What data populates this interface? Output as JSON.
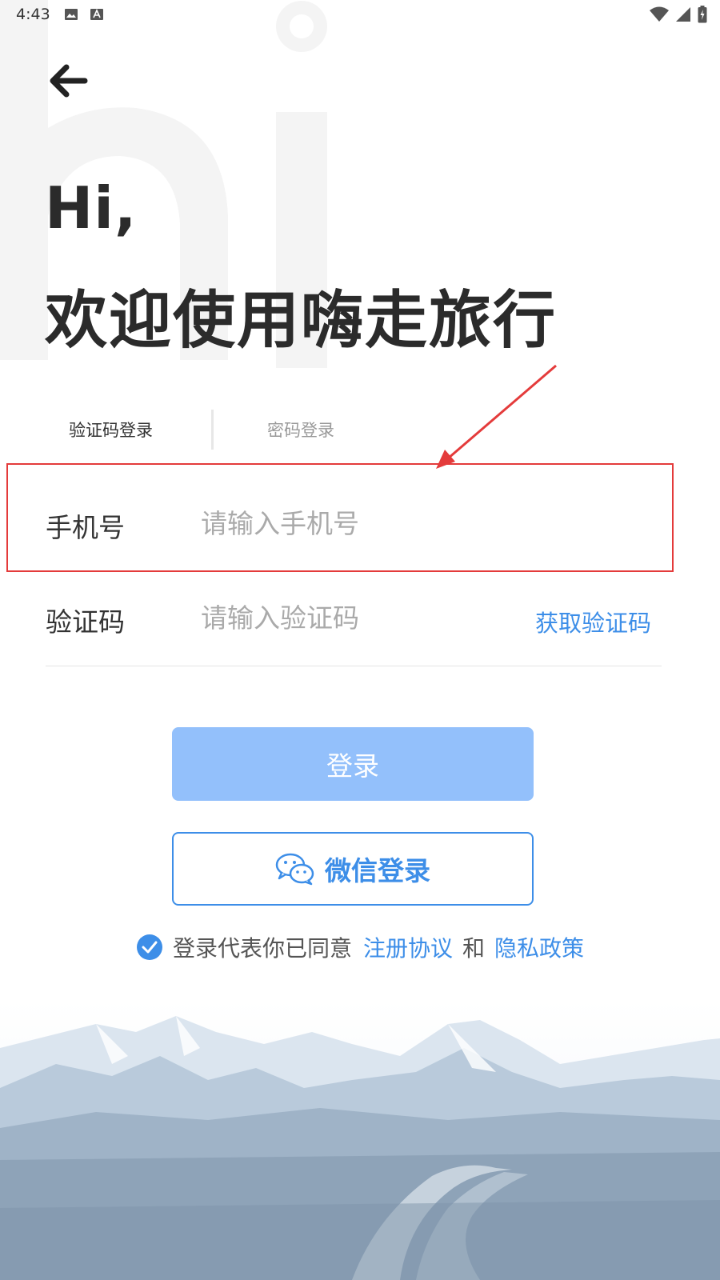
{
  "status_bar": {
    "time": "4:43"
  },
  "greeting": {
    "hi": "Hi,",
    "welcome": "欢迎使用嗨走旅行"
  },
  "tabs": [
    {
      "label": "验证码登录",
      "active": true
    },
    {
      "label": "密码登录",
      "active": false
    }
  ],
  "form": {
    "phone": {
      "label": "手机号",
      "placeholder": "请输入手机号",
      "value": ""
    },
    "code": {
      "label": "验证码",
      "placeholder": "请输入验证码",
      "value": ""
    },
    "get_code_label": "获取验证码"
  },
  "buttons": {
    "login": "登录",
    "wechat": "微信登录"
  },
  "agreement": {
    "prefix": "登录代表你已同意",
    "terms": "注册协议",
    "and": "和",
    "privacy": "隐私政策",
    "checked": true
  },
  "colors": {
    "accent": "#3d8ee8",
    "login_button_bg": "#93c0fb",
    "annotation": "#e43b3b"
  }
}
